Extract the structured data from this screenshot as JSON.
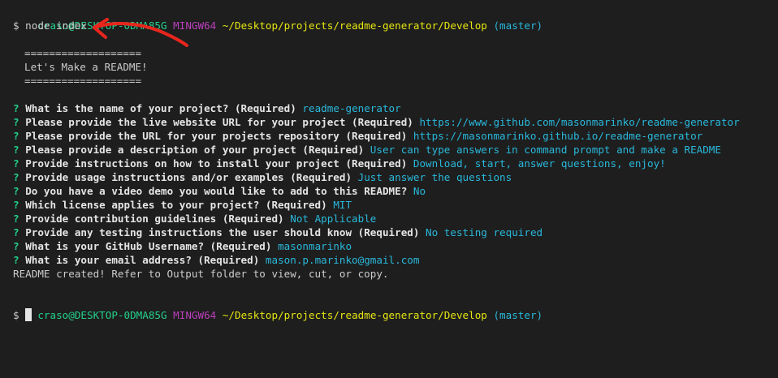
{
  "colors": {
    "background": "#1e1e1e",
    "user": "#23d18b",
    "system": "#bc3fbc",
    "path": "#e5e510",
    "branch": "#29b8db",
    "answer": "#29b8db",
    "annotation": "#e8261d"
  },
  "prompt1": {
    "user": "craso@DESKTOP-0DMA85G",
    "system": "MINGW64",
    "path": "~/Desktop/projects/readme-generator/Develop",
    "branch": "(master)"
  },
  "command": "$ node index",
  "banner": {
    "rule_top": "===================",
    "title": "Let's Make a README!",
    "rule_bottom": "==================="
  },
  "qa": [
    {
      "mark": "?",
      "question": "What is the name of your project? (Required)",
      "answer": "readme-generator"
    },
    {
      "mark": "?",
      "question": "Please provide the live website URL for your project (Required)",
      "answer": "https://www.github.com/masonmarinko/readme-generator"
    },
    {
      "mark": "?",
      "question": "Please provide the URL for your projects repository (Required)",
      "answer": "https://masonmarinko.github.io/readme-generator"
    },
    {
      "mark": "?",
      "question": "Please provide a description of your project (Required)",
      "answer": "User can type answers in command prompt and make a README"
    },
    {
      "mark": "?",
      "question": "Provide instructions on how to install your project (Required)",
      "answer": "Download, start, answer questions, enjoy!"
    },
    {
      "mark": "?",
      "question": "Provide usage instructions and/or examples (Required)",
      "answer": "Just answer the questions"
    },
    {
      "mark": "?",
      "question": "Do you have a video demo you would like to add to this README?",
      "answer": "No"
    },
    {
      "mark": "?",
      "question": "Which license applies to your project? (Required)",
      "answer": "MIT"
    },
    {
      "mark": "?",
      "question": "Provide contribution guidelines (Required)",
      "answer": "Not Applicable"
    },
    {
      "mark": "?",
      "question": "Provide any testing instructions the user should know (Required)",
      "answer": "No testing required"
    },
    {
      "mark": "?",
      "question": "What is your GitHub Username? (Required)",
      "answer": "masonmarinko"
    },
    {
      "mark": "?",
      "question": "What is your email address? (Required)",
      "answer": "mason.p.marinko@gmail.com"
    }
  ],
  "result": "README created! Refer to Output folder to view, cut, or copy.",
  "prompt2": {
    "user": "craso@DESKTOP-0DMA85G",
    "system": "MINGW64",
    "path": "~/Desktop/projects/readme-generator/Develop",
    "branch": "(master)"
  },
  "input_prompt": "$",
  "icons": {
    "annotation": "red-hand-drawn-arrow-icon",
    "cursor": "block-cursor-icon"
  }
}
